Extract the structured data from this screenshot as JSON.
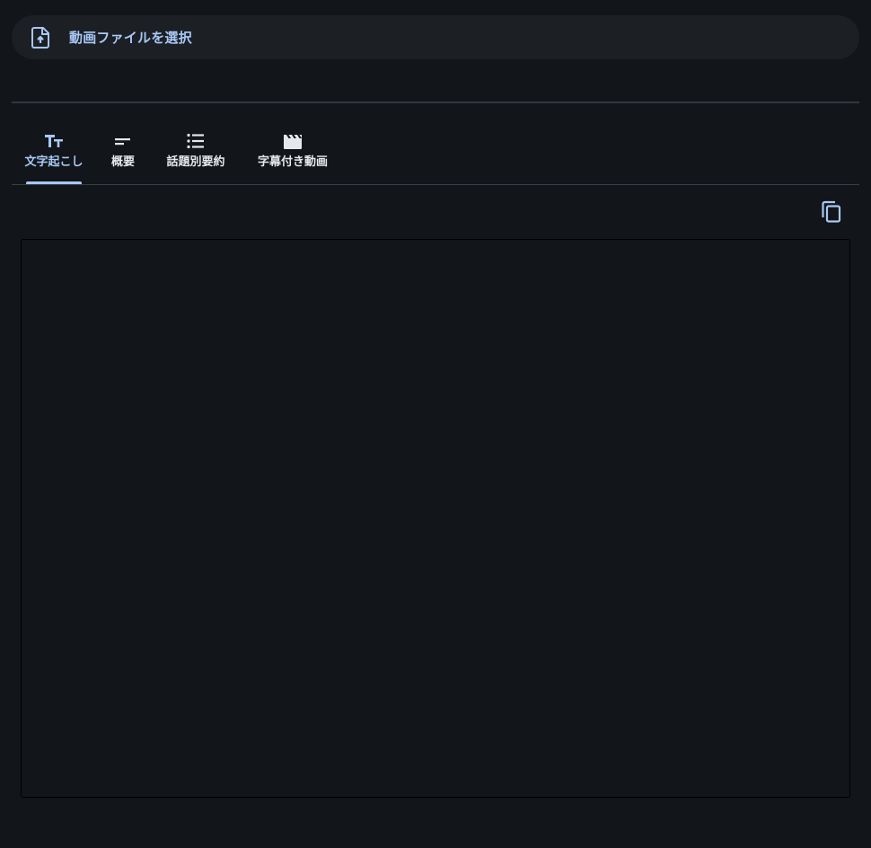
{
  "file_select": {
    "label": "動画ファイルを選択",
    "icon": "file-upload-icon"
  },
  "tabs": [
    {
      "label": "文字起こし",
      "icon": "text-fields-icon",
      "active": true
    },
    {
      "label": "概要",
      "icon": "short-text-icon",
      "active": false
    },
    {
      "label": "話題別要約",
      "icon": "list-icon",
      "active": false
    },
    {
      "label": "字幕付き動画",
      "icon": "movie-icon",
      "active": false
    }
  ],
  "copy_button": {
    "icon": "copy-icon"
  },
  "transcript": {
    "value": ""
  },
  "colors": {
    "background": "#121519",
    "accent": "#a8c8f5",
    "surface": "#1c1f24",
    "text": "#e6e8eb"
  }
}
